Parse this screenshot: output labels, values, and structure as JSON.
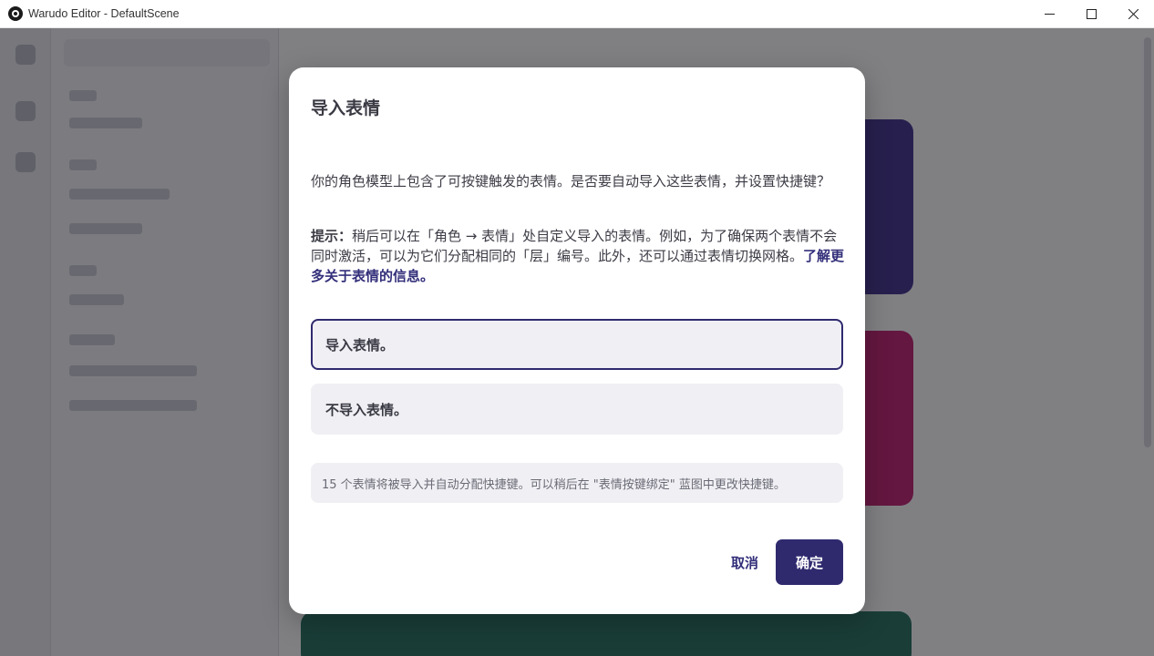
{
  "window": {
    "title": "Warudo Editor - DefaultScene",
    "app_icon": "warudo-logo-icon",
    "controls": [
      "minimize-icon",
      "maximize-icon",
      "close-icon"
    ]
  },
  "dialog": {
    "title": "导入表情",
    "body": "你的角色模型上包含了可按键触发的表情。是否要自动导入这些表情，并设置快捷键？",
    "hint_label": "提示：",
    "hint_text": "稍后可以在「角色 → 表情」处自定义导入的表情。例如，为了确保两个表情不会同时激活，可以为它们分配相同的「层」编号。此外，还可以通过表情切换网格。",
    "learn_more_link": "了解更多关于表情的信息。",
    "options": [
      {
        "label": "导入表情。",
        "selected": true
      },
      {
        "label": "不导入表情。",
        "selected": false
      }
    ],
    "info": "15 个表情将被导入并自动分配快捷键。可以稍后在 \"表情按键绑定\" 蓝图中更改快捷键。",
    "cancel_label": "取消",
    "confirm_label": "确定"
  },
  "colors": {
    "accent": "#2f2a6e",
    "overlay": "rgba(24,24,30,0.55)",
    "option_bg": "#f0f0f4"
  }
}
